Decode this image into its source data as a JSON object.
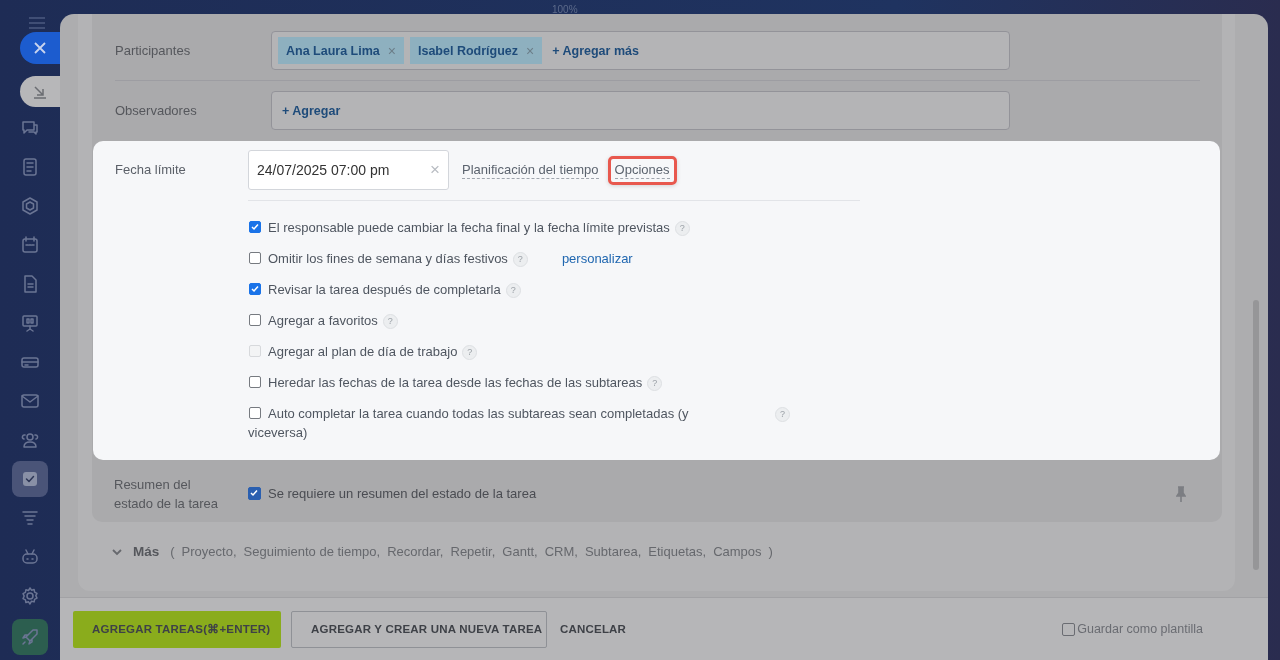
{
  "zoom_label": "100%",
  "sidebar": {
    "items": [
      {
        "selected": false
      },
      {
        "selected": false
      },
      {
        "selected": false
      },
      {
        "selected": false
      },
      {
        "selected": false
      },
      {
        "selected": false
      },
      {
        "selected": false
      },
      {
        "selected": false
      },
      {
        "selected": false
      },
      {
        "selected": true
      },
      {
        "selected": false
      },
      {
        "selected": false
      },
      {
        "selected": false
      },
      {
        "selected": false
      }
    ]
  },
  "participants": {
    "label": "Participantes",
    "chips": [
      {
        "name": "Ana Laura Lima",
        "remove": "×"
      },
      {
        "name": "Isabel Rodríguez",
        "remove": "×"
      }
    ],
    "add": "+ Agregar más"
  },
  "observers": {
    "label": "Observadores",
    "add": "+ Agregar"
  },
  "deadline": {
    "label": "Fecha límite",
    "value": "24/07/2025 07:00 pm",
    "clear": "×",
    "links": [
      {
        "label": "Planificación del tiempo",
        "highlighted": false
      },
      {
        "label": "Opciones",
        "highlighted": true
      }
    ]
  },
  "options": [
    {
      "label": "El responsable puede cambiar la fecha final y la fecha límite previstas",
      "checked": true,
      "disabled": false,
      "help": "?"
    },
    {
      "label": "Omitir los fines de semana y días festivos",
      "checked": false,
      "disabled": false,
      "help": "?",
      "link": "personalizar"
    },
    {
      "label": "Revisar la tarea después de completarla",
      "checked": true,
      "disabled": false,
      "help": "?"
    },
    {
      "label": "Agregar a favoritos",
      "checked": false,
      "disabled": false,
      "help": "?"
    },
    {
      "label": "Agregar al plan de día de trabajo",
      "checked": false,
      "disabled": true,
      "help": "?"
    },
    {
      "label": "Heredar las fechas de la tarea desde las fechas de las subtareas",
      "checked": false,
      "disabled": false,
      "help": "?"
    },
    {
      "label": "Auto completar la tarea cuando todas las subtareas sean completadas (y viceversa)",
      "checked": false,
      "disabled": false,
      "help": "?"
    }
  ],
  "summary": {
    "label": "Resumen del estado de la tarea",
    "checkbox": {
      "label": "Se requiere un resumen del estado de la tarea",
      "checked": true
    }
  },
  "more": {
    "label": "Más",
    "open_paren": "(",
    "items": [
      "Proyecto,",
      "Seguimiento de tiempo,",
      "Recordar,",
      "Repetir,",
      "Gantt,",
      "CRM,",
      "Subtarea,",
      "Etiquetas,",
      "Campos"
    ],
    "close_paren": ")"
  },
  "footer": {
    "buttons": [
      {
        "label": "AGREGAR TAREAS(⌘+ENTER)",
        "kind": "primary"
      },
      {
        "label": "AGREGAR Y CREAR UNA NUEVA TAREA",
        "kind": "outline"
      },
      {
        "label": "CANCELAR",
        "kind": "plain"
      }
    ],
    "save_template": {
      "label": "Guardar como plantilla",
      "checked": false
    }
  }
}
